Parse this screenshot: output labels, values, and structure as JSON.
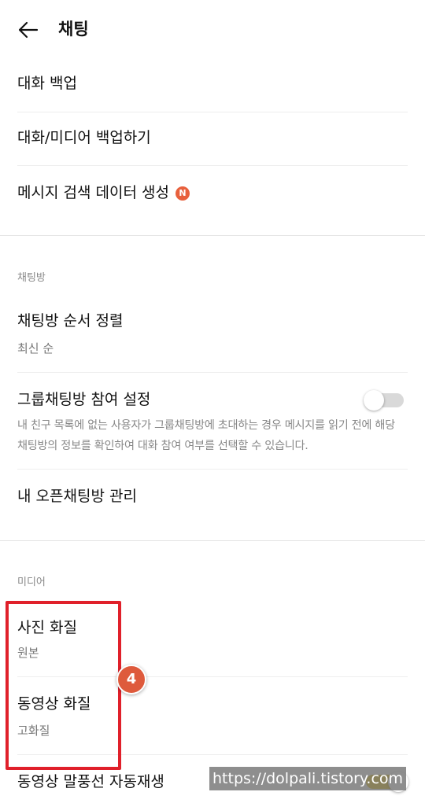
{
  "header": {
    "back_icon": "arrow-left-icon",
    "title": "채팅"
  },
  "backup_section": {
    "items": [
      {
        "title": "대화 백업"
      },
      {
        "title": "대화/미디어 백업하기"
      },
      {
        "title": "메시지 검색 데이터 생성",
        "badge": "N"
      }
    ]
  },
  "chatroom_section": {
    "label": "채팅방",
    "sort": {
      "title": "채팅방 순서 정렬",
      "value": "최신 순"
    },
    "group_join": {
      "title": "그룹채팅방 참여 설정",
      "description": "내 친구 목록에 없는 사용자가 그룹채팅방에 초대하는 경우 메시지를 읽기 전에 해당 채팅방의 정보를 확인하여 대화 참여 여부를 선택할 수 있습니다.",
      "toggle_on": false
    },
    "open_chat": {
      "title": "내 오픈채팅방 관리"
    }
  },
  "media_section": {
    "label": "미디어",
    "photo_quality": {
      "title": "사진 화질",
      "value": "원본"
    },
    "video_quality": {
      "title": "동영상 화질",
      "value": "고화질"
    },
    "autoplay": {
      "title": "동영상 말풍선 자동재생",
      "toggle_on": true
    }
  },
  "annotation": {
    "step_number": "4",
    "highlight_color": "#e0202a",
    "marker_color": "#de5a3c"
  },
  "watermark": "https://dolpali.tistory.com",
  "colors": {
    "badge": "#e8603c",
    "toggle_on": "#e6c21b",
    "toggle_off": "#d9d9d9"
  }
}
